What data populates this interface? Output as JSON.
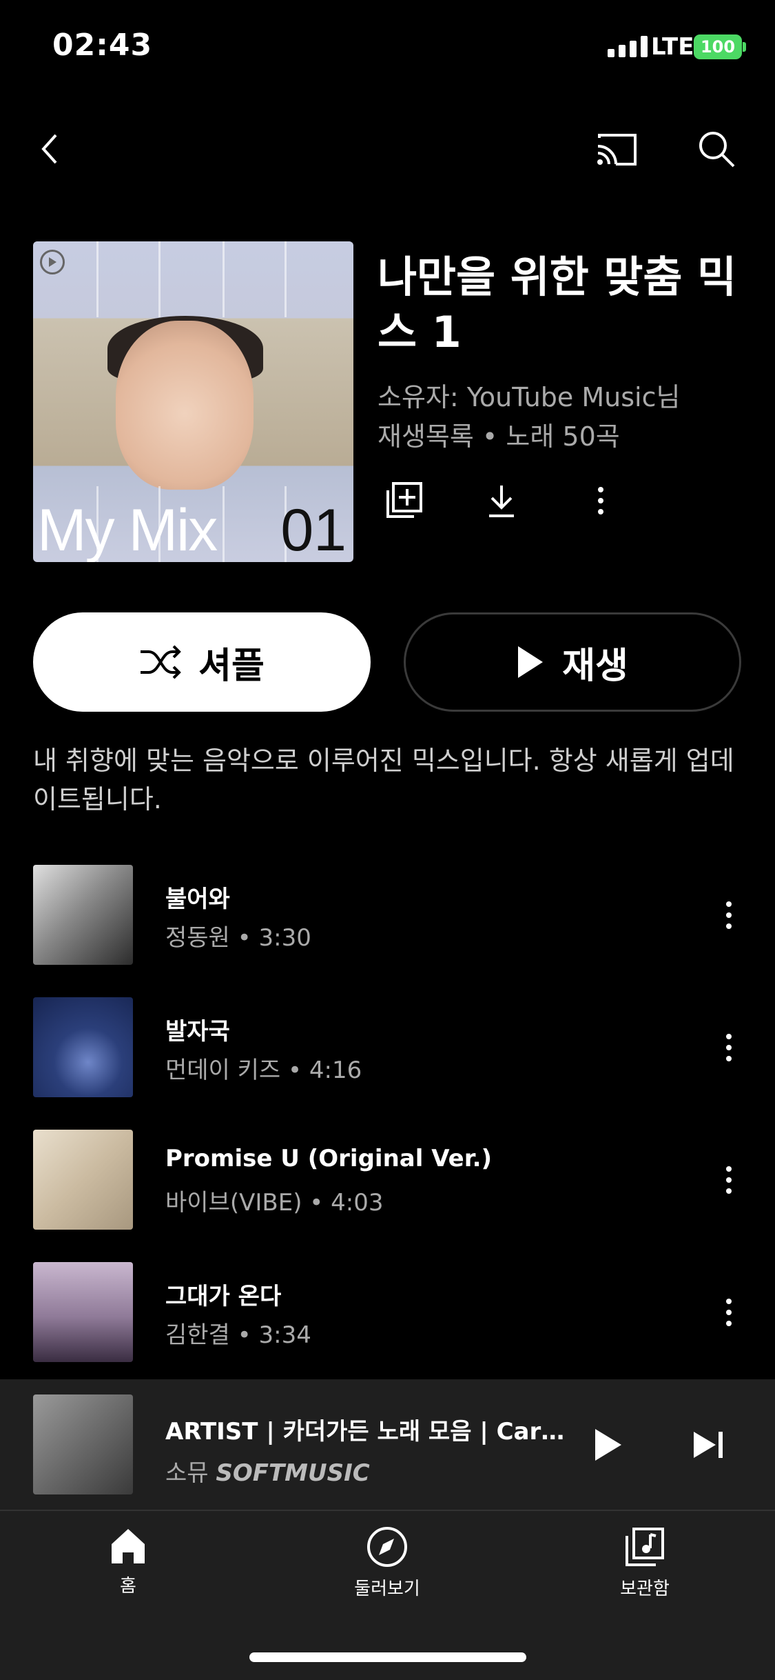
{
  "status": {
    "time": "02:43",
    "network": "LTE",
    "battery": "100"
  },
  "playlist": {
    "title": "나만을 위한 맞춤 믹스 1",
    "owner": "소유자: YouTube Music님",
    "meta": "재생목록 • 노래 50곡",
    "cover_title": "My Mix",
    "cover_number": "01",
    "description": "내 취향에 맞는 음악으로 이루어진 믹스입니다. 항상 새롭게 업데이트됩니다."
  },
  "buttons": {
    "shuffle": "셔플",
    "play": "재생"
  },
  "songs": [
    {
      "title": "불어와",
      "subtitle": "정동원 • 3:30"
    },
    {
      "title": "발자국",
      "subtitle": "먼데이 키즈 • 4:16"
    },
    {
      "title": "Promise U (Original Ver.)",
      "subtitle": "바이브(VIBE) • 4:03"
    },
    {
      "title": "그대가 온다",
      "subtitle": "김한결 • 3:34"
    }
  ],
  "now_playing": {
    "title": "ARTIST | 카더가든 노래 모음 | Car the...",
    "artist": "소뮤",
    "channel": "SOFTMUSIC"
  },
  "nav": {
    "home": "홈",
    "explore": "둘러보기",
    "library": "보관함"
  },
  "colors": {
    "background": "#000000",
    "battery": "#4cd964",
    "panel": "#1f1f1f"
  }
}
